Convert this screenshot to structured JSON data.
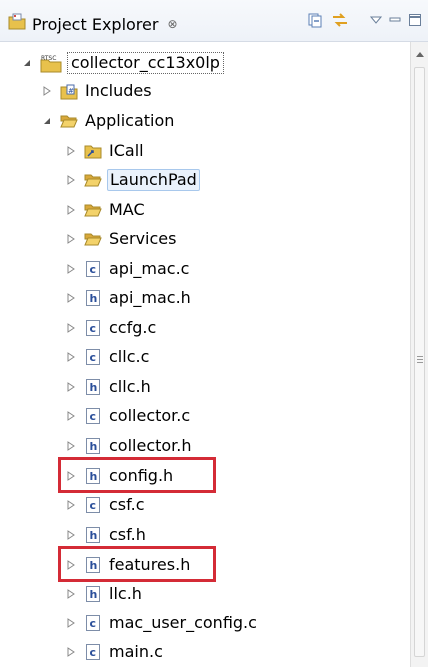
{
  "panel": {
    "title": "Project Explorer",
    "close_glyph": "⊗"
  },
  "toolbar": {
    "icons": [
      "collapse-all-icon",
      "link-with-editor-icon",
      "view-menu-icon",
      "minimize-icon",
      "maximize-icon"
    ]
  },
  "tree": {
    "project": {
      "label": "collector_cc13x0lp",
      "badge": "RTSC"
    },
    "includes": {
      "label": "Includes"
    },
    "application": {
      "label": "Application"
    },
    "folders": [
      {
        "label": "ICall"
      },
      {
        "label": "LaunchPad"
      },
      {
        "label": "MAC"
      },
      {
        "label": "Services"
      }
    ],
    "files": [
      {
        "label": "api_mac.c",
        "type": "c"
      },
      {
        "label": "api_mac.h",
        "type": "h"
      },
      {
        "label": "ccfg.c",
        "type": "c"
      },
      {
        "label": "cllc.c",
        "type": "c"
      },
      {
        "label": "cllc.h",
        "type": "h"
      },
      {
        "label": "collector.c",
        "type": "c"
      },
      {
        "label": "collector.h",
        "type": "h"
      },
      {
        "label": "config.h",
        "type": "h"
      },
      {
        "label": "csf.c",
        "type": "c"
      },
      {
        "label": "csf.h",
        "type": "h"
      },
      {
        "label": "features.h",
        "type": "h"
      },
      {
        "label": "llc.h",
        "type": "h"
      },
      {
        "label": "mac_user_config.c",
        "type": "c"
      },
      {
        "label": "main.c",
        "type": "c"
      }
    ],
    "icon_letters": {
      "c": "c",
      "h": "h"
    }
  },
  "colors": {
    "highlight": "#d42b36",
    "folder": "#e8c14c",
    "file_letter": "#2b4f9a",
    "selection": "#eaf2fc"
  }
}
